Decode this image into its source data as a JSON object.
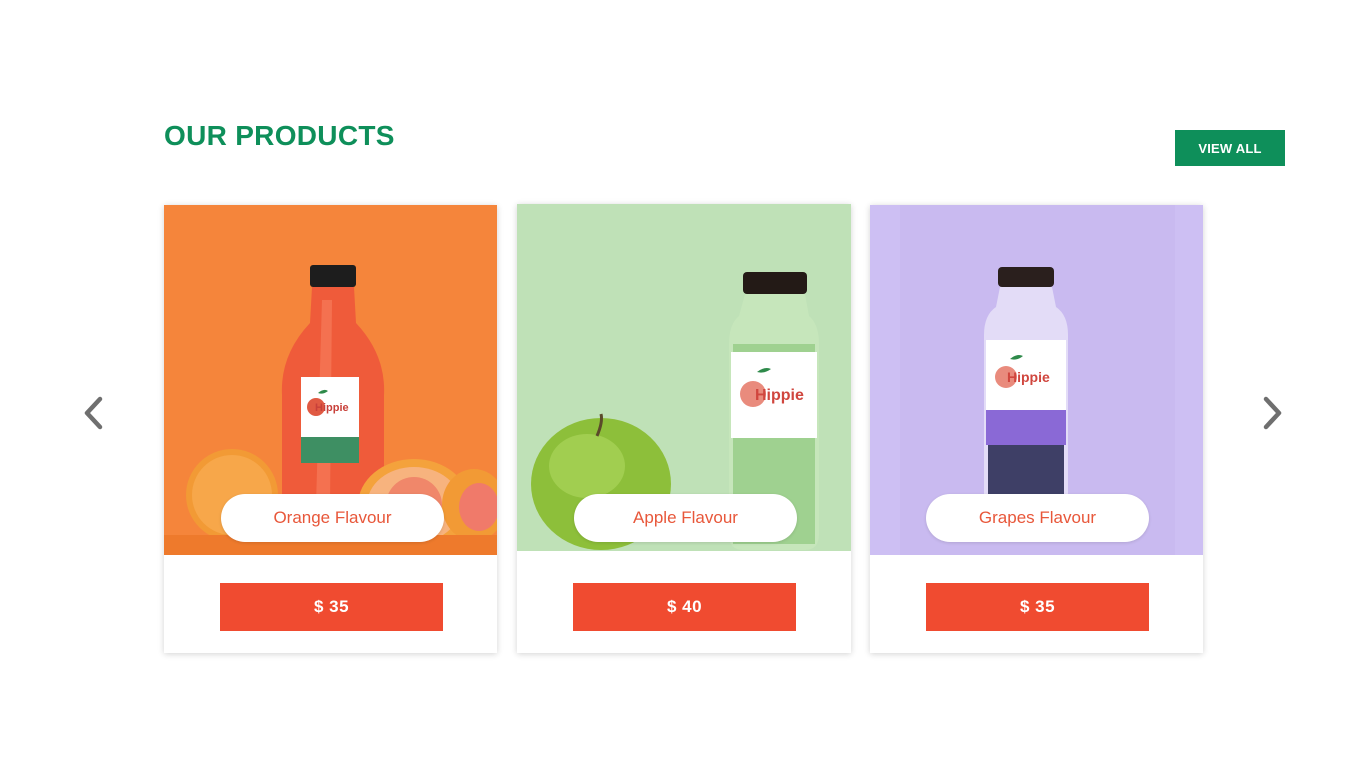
{
  "section": {
    "title": "OUR PRODUCTS",
    "view_all_label": "VIEW ALL"
  },
  "colors": {
    "brand_green": "#0e8f5a",
    "price_red": "#f04b30",
    "flavour_text": "#e8573a"
  },
  "navigation": {
    "prev_icon": "chevron-left-icon",
    "next_icon": "chevron-right-icon"
  },
  "products": [
    {
      "flavour": "Orange Flavour",
      "price": "$ 35",
      "background": "#f5853b",
      "juice_color": "#ef5b3a",
      "fruit": "grapefruit",
      "label_brand": "Hippie"
    },
    {
      "flavour": "Apple Flavour",
      "price": "$ 40",
      "background": "#bfe1b7",
      "juice_color": "#a6d69a",
      "fruit": "green-apple",
      "label_brand": "Hippie"
    },
    {
      "flavour": "Grapes Flavour",
      "price": "$ 35",
      "background": "#cdbff3",
      "juice_color": "#3e3f66",
      "fruit": "none",
      "label_brand": "Hippie"
    }
  ]
}
